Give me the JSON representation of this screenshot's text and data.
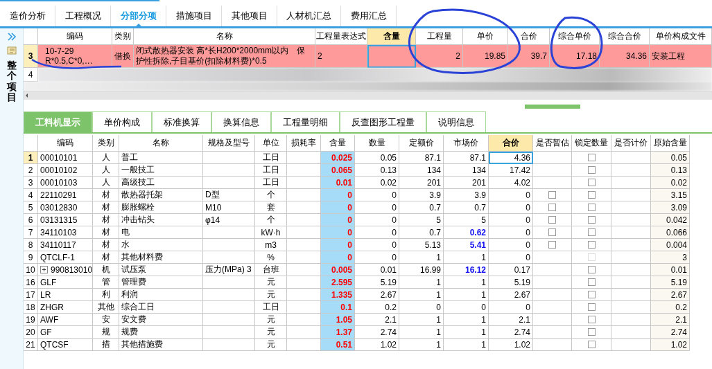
{
  "top_tabs": [
    {
      "label": "造价分析",
      "selected": false
    },
    {
      "label": "工程概况",
      "selected": false
    },
    {
      "label": "分部分项",
      "selected": true
    },
    {
      "label": "措施项目",
      "selected": false
    },
    {
      "label": "其他项目",
      "selected": false
    },
    {
      "label": "人材机汇总",
      "selected": false
    },
    {
      "label": "费用汇总",
      "selected": false
    }
  ],
  "sidebar": {
    "label": "整个项目"
  },
  "upper_grid": {
    "columns": [
      {
        "label": "编码",
        "current": false
      },
      {
        "label": "类别",
        "current": false
      },
      {
        "label": "名称",
        "current": false
      },
      {
        "label": "工程量表达式",
        "current": false
      },
      {
        "label": "含量",
        "current": true
      },
      {
        "label": "工程量",
        "current": false
      },
      {
        "label": "单价",
        "current": false
      },
      {
        "label": "合价",
        "current": false
      },
      {
        "label": "综合单价",
        "current": false
      },
      {
        "label": "综合合价",
        "current": false
      },
      {
        "label": "单价构成文件",
        "current": false
      }
    ],
    "rows": [
      {
        "kind": "item",
        "row_number": "3",
        "selected": true,
        "code": "10-7-29",
        "code_line_2": "R*0.5,C*0,…",
        "category": "借换",
        "name": "闭式散热器安装 高*长H200*2000mm以内　保护性拆除,子目基价(扣除材料费)*0.5",
        "expression": "2",
        "quantity": "2",
        "unit_price": "19.85",
        "total": "39.7",
        "composite_unit_price": "17.18",
        "composite_total": "34.36",
        "pricing_file": "安装工程"
      },
      {
        "kind": "redacted",
        "row_number": "4",
        "selected": false
      }
    ]
  },
  "lower_tabs": [
    {
      "label": "工料机显示",
      "selected": true
    },
    {
      "label": "单价构成",
      "selected": false
    },
    {
      "label": "标准换算",
      "selected": false
    },
    {
      "label": "换算信息",
      "selected": false
    },
    {
      "label": "工程量明细",
      "selected": false
    },
    {
      "label": "反查图形工程量",
      "selected": false
    },
    {
      "label": "说明信息",
      "selected": false
    }
  ],
  "lower_grid": {
    "columns": [
      {
        "label": "编码",
        "current": false
      },
      {
        "label": "类别",
        "current": false
      },
      {
        "label": "名称",
        "current": false
      },
      {
        "label": "规格及型号",
        "current": false
      },
      {
        "label": "单位",
        "current": false
      },
      {
        "label": "损耗率",
        "current": false
      },
      {
        "label": "含量",
        "current": false
      },
      {
        "label": "数量",
        "current": false
      },
      {
        "label": "定额价",
        "current": false
      },
      {
        "label": "市场价",
        "current": false
      },
      {
        "label": "合价",
        "current": true
      },
      {
        "label": "是否暂估",
        "current": false
      },
      {
        "label": "锁定数量",
        "current": false
      },
      {
        "label": "是否计价",
        "current": false
      },
      {
        "label": "原始含量",
        "current": false
      }
    ],
    "rows": [
      {
        "row_number": "1",
        "selected": true,
        "code": "00010101",
        "expandable": false,
        "category": "人",
        "name": "普工",
        "unit": "工日",
        "content": "0.025",
        "quantity": "0.05",
        "quota_price": "87.1",
        "market_price": "87.1",
        "market_adjusted": false,
        "total": "4.36",
        "locked": false,
        "lock_disabled": false,
        "original_content": "0.05"
      },
      {
        "row_number": "2",
        "selected": false,
        "code": "00010102",
        "expandable": false,
        "category": "人",
        "name": "一般技工",
        "unit": "工日",
        "content": "0.065",
        "quantity": "0.13",
        "quota_price": "134",
        "market_price": "134",
        "market_adjusted": false,
        "total": "17.42",
        "locked": false,
        "lock_disabled": false,
        "original_content": "0.13"
      },
      {
        "row_number": "3",
        "selected": false,
        "code": "00010103",
        "expandable": false,
        "category": "人",
        "name": "高级技工",
        "unit": "工日",
        "content": "0.01",
        "quantity": "0.02",
        "quota_price": "201",
        "market_price": "201",
        "market_adjusted": false,
        "total": "4.02",
        "locked": false,
        "lock_disabled": false,
        "original_content": "0.02"
      },
      {
        "row_number": "4",
        "selected": false,
        "code": "22110291",
        "expandable": false,
        "category": "材",
        "name": "散热器托架",
        "spec": "D型",
        "unit": "个",
        "content": "0",
        "quantity": "0",
        "quota_price": "3.9",
        "market_price": "3.9",
        "market_adjusted": false,
        "total": "0",
        "estimate": false,
        "locked": false,
        "lock_disabled": false,
        "original_content": "3.15"
      },
      {
        "row_number": "5",
        "selected": false,
        "code": "03012830",
        "expandable": false,
        "category": "材",
        "name": "膨胀螺栓",
        "spec": "M10",
        "unit": "套",
        "content": "0",
        "quantity": "0",
        "quota_price": "0.7",
        "market_price": "0.7",
        "market_adjusted": false,
        "total": "0",
        "estimate": false,
        "locked": false,
        "lock_disabled": false,
        "original_content": "3.09"
      },
      {
        "row_number": "6",
        "selected": false,
        "code": "03131315",
        "expandable": false,
        "category": "材",
        "name": "冲击钻头",
        "spec": "φ14",
        "unit": "个",
        "content": "0",
        "quantity": "0",
        "quota_price": "5",
        "market_price": "5",
        "market_adjusted": false,
        "total": "0",
        "estimate": false,
        "locked": false,
        "lock_disabled": false,
        "original_content": "0.042"
      },
      {
        "row_number": "7",
        "selected": false,
        "code": "34110103",
        "expandable": false,
        "category": "材",
        "name": "电",
        "unit": "kW·h",
        "content": "0",
        "quantity": "0",
        "quota_price": "0.7",
        "market_price": "0.62",
        "market_adjusted": true,
        "total": "0",
        "estimate": false,
        "locked": false,
        "lock_disabled": false,
        "original_content": "0.066"
      },
      {
        "row_number": "8",
        "selected": false,
        "code": "34110117",
        "expandable": false,
        "category": "材",
        "name": "水",
        "unit": "m3",
        "content": "0",
        "quantity": "0",
        "quota_price": "5.13",
        "market_price": "5.41",
        "market_adjusted": true,
        "total": "0",
        "estimate": false,
        "locked": false,
        "lock_disabled": false,
        "original_content": "0.004"
      },
      {
        "row_number": "9",
        "selected": false,
        "code": "QTCLF-1",
        "expandable": false,
        "category": "材",
        "name": "其他材料费",
        "unit": "%",
        "content": "0",
        "quantity": "0",
        "quota_price": "1",
        "market_price": "1",
        "market_adjusted": false,
        "total": "0",
        "locked": false,
        "lock_disabled": true,
        "original_content": "3"
      },
      {
        "row_number": "10",
        "selected": false,
        "code": "990813010",
        "expandable": true,
        "category": "机",
        "name": "试压泵",
        "spec": "压力(MPa) 3",
        "unit": "台班",
        "content": "0.005",
        "quantity": "0.01",
        "quota_price": "16.99",
        "market_price": "16.12",
        "market_adjusted": true,
        "total": "0.17",
        "locked": false,
        "lock_disabled": false,
        "original_content": "0.01"
      },
      {
        "row_number": "16",
        "selected": false,
        "code": "GLF",
        "expandable": false,
        "category": "管",
        "name": "管理费",
        "unit": "元",
        "content": "2.595",
        "quantity": "5.19",
        "quota_price": "1",
        "market_price": "1",
        "market_adjusted": false,
        "total": "5.19",
        "locked": false,
        "lock_disabled": false,
        "original_content": "5.19"
      },
      {
        "row_number": "17",
        "selected": false,
        "code": "LR",
        "expandable": false,
        "category": "利",
        "name": "利润",
        "unit": "元",
        "content": "1.335",
        "quantity": "2.67",
        "quota_price": "1",
        "market_price": "1",
        "market_adjusted": false,
        "total": "2.67",
        "locked": false,
        "lock_disabled": false,
        "original_content": "2.67"
      },
      {
        "row_number": "18",
        "selected": false,
        "code": "ZHGR",
        "expandable": false,
        "category": "其他",
        "name": "综合工日",
        "unit": "工日",
        "content": "0.1",
        "quantity": "0.2",
        "quota_price": "0",
        "market_price": "0",
        "market_adjusted": false,
        "total": "0",
        "locked": false,
        "lock_disabled": false,
        "original_content": "0.2"
      },
      {
        "row_number": "19",
        "selected": false,
        "code": "AWF",
        "expandable": false,
        "category": "安",
        "name": "安文费",
        "unit": "元",
        "content": "1.05",
        "quantity": "2.1",
        "quota_price": "1",
        "market_price": "1",
        "market_adjusted": false,
        "total": "2.1",
        "locked": false,
        "lock_disabled": false,
        "original_content": "2.1"
      },
      {
        "row_number": "20",
        "selected": false,
        "code": "GF",
        "expandable": false,
        "category": "规",
        "name": "规费",
        "unit": "元",
        "content": "1.37",
        "quantity": "2.74",
        "quota_price": "1",
        "market_price": "1",
        "market_adjusted": false,
        "total": "2.74",
        "locked": false,
        "lock_disabled": false,
        "original_content": "2.74"
      },
      {
        "row_number": "21",
        "selected": false,
        "code": "QTCSF",
        "expandable": false,
        "category": "措",
        "name": "其他措施费",
        "unit": "元",
        "content": "0.51",
        "quantity": "1.02",
        "quota_price": "1",
        "market_price": "1",
        "market_adjusted": false,
        "total": "1.02",
        "locked": false,
        "lock_disabled": false,
        "original_content": "1.02"
      }
    ]
  }
}
